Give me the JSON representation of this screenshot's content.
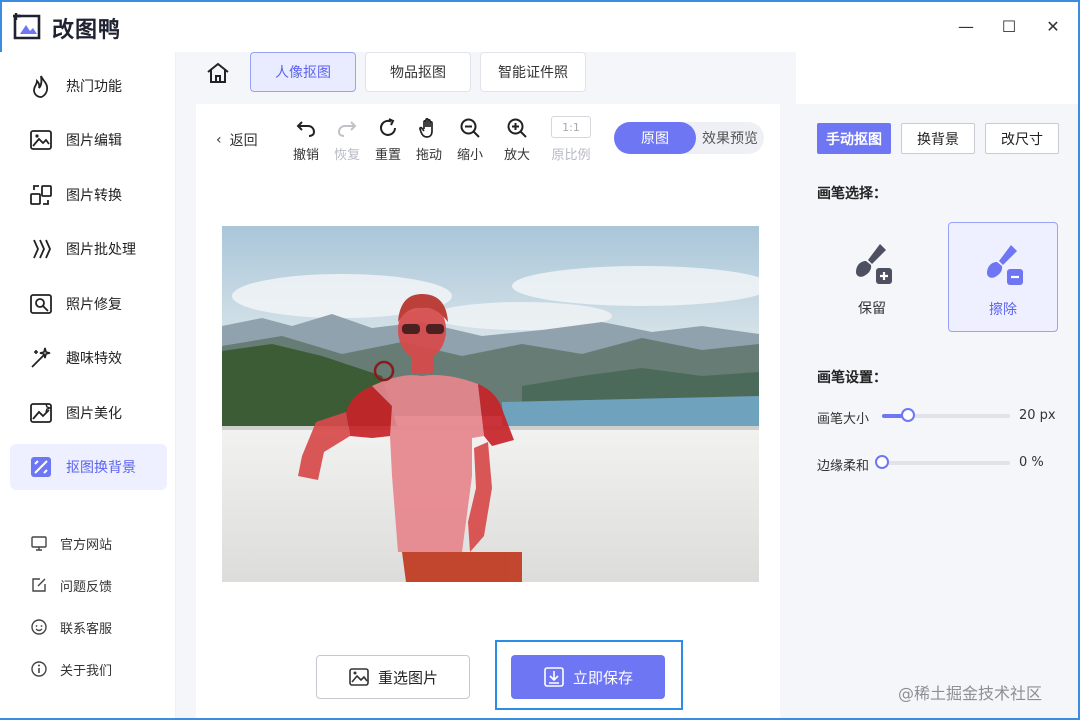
{
  "app": {
    "title": "改图鸭",
    "accent": "#6f76f3",
    "frame_color": "#3a8de0"
  },
  "window_controls": {
    "minimize": "—",
    "maximize": "☐",
    "close": "✕"
  },
  "sidebar": {
    "items": [
      {
        "label": "热门功能",
        "icon": "flame-icon"
      },
      {
        "label": "图片编辑",
        "icon": "image-edit-icon"
      },
      {
        "label": "图片转换",
        "icon": "convert-icon"
      },
      {
        "label": "图片批处理",
        "icon": "batch-icon"
      },
      {
        "label": "照片修复",
        "icon": "repair-icon"
      },
      {
        "label": "趣味特效",
        "icon": "sparkle-icon"
      },
      {
        "label": "图片美化",
        "icon": "beautify-icon"
      },
      {
        "label": "抠图换背景",
        "icon": "cutout-icon",
        "active": true
      }
    ],
    "links": [
      {
        "label": "官方网站",
        "icon": "monitor-icon"
      },
      {
        "label": "问题反馈",
        "icon": "feedback-icon"
      },
      {
        "label": "联系客服",
        "icon": "support-icon"
      },
      {
        "label": "关于我们",
        "icon": "info-icon"
      }
    ]
  },
  "tabs": [
    {
      "label": "人像抠图",
      "active": true
    },
    {
      "label": "物品抠图"
    },
    {
      "label": "智能证件照"
    }
  ],
  "toolbar": {
    "back": "返回",
    "tools": [
      {
        "label": "撤销",
        "icon": "undo-icon"
      },
      {
        "label": "恢复",
        "icon": "redo-icon",
        "disabled": true
      },
      {
        "label": "重置",
        "icon": "reset-icon"
      },
      {
        "label": "拖动",
        "icon": "hand-icon"
      },
      {
        "label": "缩小",
        "icon": "zoom-out-icon"
      },
      {
        "label": "放大",
        "icon": "zoom-in-icon"
      },
      {
        "label": "原比例",
        "icon": "ratio-icon",
        "disabled": true,
        "box_text": "1:1"
      }
    ],
    "view_original": "原图",
    "view_preview": "效果预览"
  },
  "actions": {
    "reselect": "重选图片",
    "save": "立即保存"
  },
  "right_panel": {
    "modes": [
      {
        "label": "手动抠图",
        "active": true
      },
      {
        "label": "换背景"
      },
      {
        "label": "改尺寸"
      }
    ],
    "brush_select_title": "画笔选择：",
    "brushes": [
      {
        "label": "保留",
        "icon": "brush-keep-icon"
      },
      {
        "label": "擦除",
        "icon": "brush-erase-icon",
        "active": true
      }
    ],
    "brush_settings_title": "画笔设置：",
    "brush_size": {
      "label": "画笔大小",
      "value": 20,
      "unit": "px",
      "display": "20 px",
      "fraction": 0.2
    },
    "edge_feather": {
      "label": "边缘柔和",
      "value": 0,
      "unit": "%",
      "display": "0 %",
      "fraction": 0
    }
  },
  "watermark": "@稀土掘金技术社区"
}
